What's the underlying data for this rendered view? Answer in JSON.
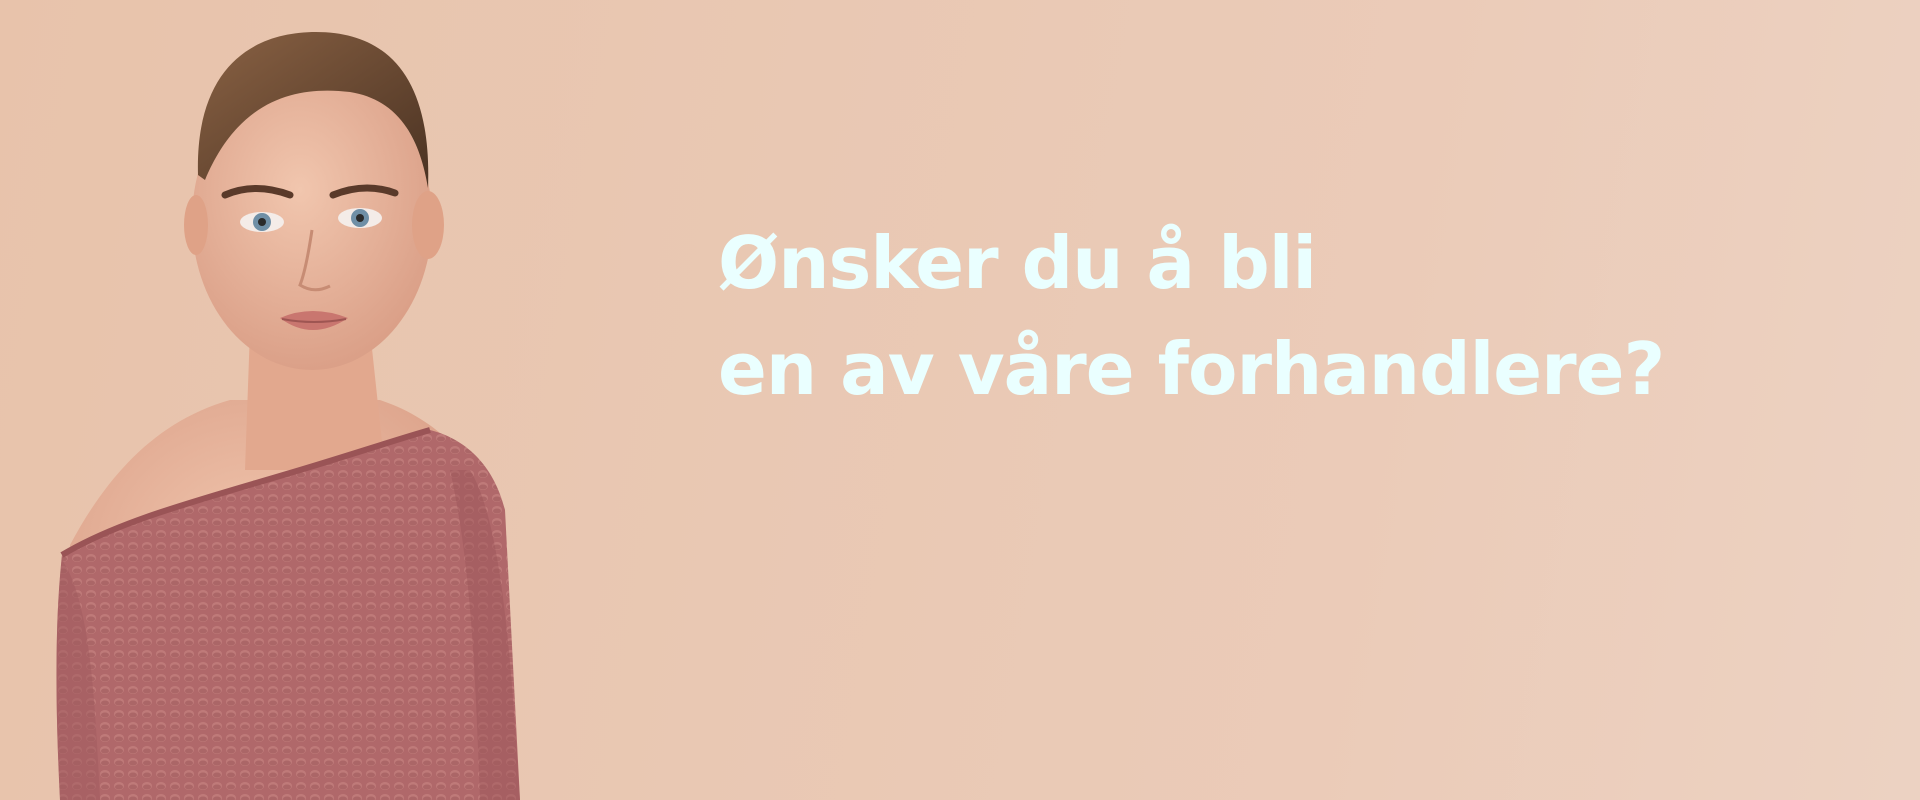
{
  "banner": {
    "headline_line1": "Ønsker du å bli",
    "headline_line2": "en av våre forhandlere?",
    "image_alt": "Model in rose knit off-shoulder sweater"
  },
  "colors": {
    "background": "#e9c7b2",
    "headline": "#eaffff",
    "sweater": "#b0686a",
    "skin": "#e8b39a",
    "hair": "#6b4a36"
  }
}
